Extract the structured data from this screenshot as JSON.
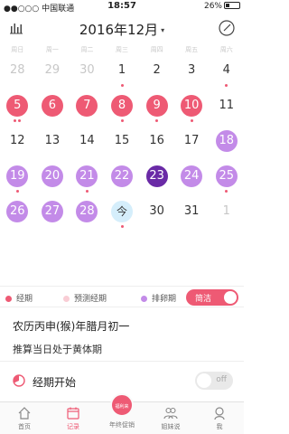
{
  "status_bar": {
    "carrier": "●●○○○ 中国联通",
    "time": "18:57",
    "battery": "26%"
  },
  "header": {
    "title": "2016年12月",
    "caret": "▾",
    "stats_icon": "bar-chart-icon",
    "edit_icon": "edit-circle-icon"
  },
  "weekdays": [
    "周日",
    "周一",
    "周二",
    "周三",
    "周四",
    "周五",
    "周六"
  ],
  "calendar": {
    "weeks": [
      [
        {
          "label": "28",
          "type": "prev"
        },
        {
          "label": "29",
          "type": "prev"
        },
        {
          "label": "30",
          "type": "prev"
        },
        {
          "label": "1",
          "type": "normal",
          "dots": 1
        },
        {
          "label": "2",
          "type": "normal"
        },
        {
          "label": "3",
          "type": "normal"
        },
        {
          "label": "4",
          "type": "normal",
          "dots": 1
        }
      ],
      [
        {
          "label": "5",
          "type": "period",
          "dots": 2
        },
        {
          "label": "6",
          "type": "period"
        },
        {
          "label": "7",
          "type": "period"
        },
        {
          "label": "8",
          "type": "period",
          "dots": 1
        },
        {
          "label": "9",
          "type": "period",
          "dots": 1
        },
        {
          "label": "10",
          "type": "period",
          "dots": 1
        },
        {
          "label": "11",
          "type": "normal"
        }
      ],
      [
        {
          "label": "12",
          "type": "normal"
        },
        {
          "label": "13",
          "type": "normal"
        },
        {
          "label": "14",
          "type": "normal"
        },
        {
          "label": "15",
          "type": "normal"
        },
        {
          "label": "16",
          "type": "normal"
        },
        {
          "label": "17",
          "type": "normal"
        },
        {
          "label": "18",
          "type": "ovu"
        }
      ],
      [
        {
          "label": "19",
          "type": "ovu",
          "dots": 1
        },
        {
          "label": "20",
          "type": "ovu"
        },
        {
          "label": "21",
          "type": "ovu",
          "dots": 1
        },
        {
          "label": "22",
          "type": "ovu"
        },
        {
          "label": "23",
          "type": "sel"
        },
        {
          "label": "24",
          "type": "ovu"
        },
        {
          "label": "25",
          "type": "ovu",
          "dots": 1
        }
      ],
      [
        {
          "label": "26",
          "type": "ovu"
        },
        {
          "label": "27",
          "type": "ovu"
        },
        {
          "label": "28",
          "type": "ovu"
        },
        {
          "label": "今",
          "type": "today",
          "dots": 1
        },
        {
          "label": "30",
          "type": "normal"
        },
        {
          "label": "31",
          "type": "normal"
        },
        {
          "label": "1",
          "type": "prev"
        }
      ]
    ]
  },
  "legend": {
    "period": "经期",
    "predicted": "预测经期",
    "ovulation": "排卵期",
    "toggle": "简洁"
  },
  "info": {
    "lunar": "农历丙申(猴)年腊月初一",
    "hint": "推算当日处于黄体期"
  },
  "period_start": {
    "label": "经期开始",
    "toggle": "off"
  },
  "tabs": [
    {
      "label": "首页",
      "icon": "home-icon"
    },
    {
      "label": "记录",
      "icon": "calendar-icon"
    },
    {
      "label": "年终促销",
      "icon": "promo-badge-icon",
      "badge": "福利来"
    },
    {
      "label": "姐妹说",
      "icon": "sisters-icon"
    },
    {
      "label": "我",
      "icon": "profile-icon"
    }
  ],
  "colors": {
    "period": "#ee5a74",
    "predicted": "#f9cdd5",
    "ovulation": "#c38be8",
    "selected": "#6a2aa6",
    "today": "#d5eefb"
  }
}
